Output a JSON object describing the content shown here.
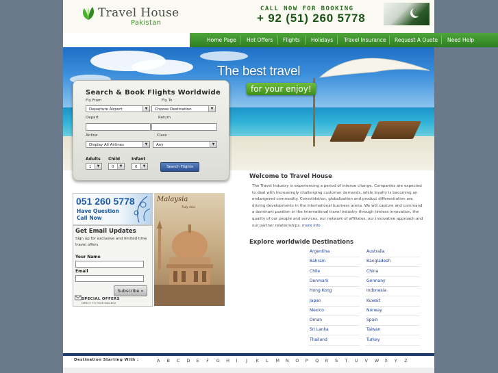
{
  "brand": {
    "name": "Travel House",
    "sub": "Pakistan"
  },
  "contact": {
    "call_label": "CALL NOW FOR BOOKING",
    "phone": "+ 92 (51) 260 5778"
  },
  "nav": {
    "items": [
      {
        "label": "Home Page"
      },
      {
        "label": "Hot Offers"
      },
      {
        "label": "Flights"
      },
      {
        "label": "Holidays"
      },
      {
        "label": "Travel Insurance"
      },
      {
        "label": "Request A Quote"
      },
      {
        "label": "Need Help"
      }
    ]
  },
  "hero": {
    "slogan_top": "The best travel",
    "slogan_bottom": "for your enjoy!"
  },
  "search": {
    "title": "Search & Book Flights Worldwide",
    "fly_from_label": "Fly From",
    "fly_from_value": "Departure Airport",
    "fly_to_label": "Fly To",
    "fly_to_value": "Choose Destination",
    "depart_label": "Depart",
    "return_label": "Return",
    "airline_label": "Airline",
    "airline_value": "Display All Airlines",
    "class_label": "Class",
    "class_value": "Any",
    "adults_label": "Adults",
    "adults_value": "1",
    "child_label": "Child",
    "child_value": "0",
    "infant_label": "Infant",
    "infant_value": "0",
    "button": "Search Flights"
  },
  "ad_phone": {
    "number": "051 260 5778",
    "line1": "Have Question",
    "line2": "Call Now"
  },
  "email": {
    "title": "Get Email Updates",
    "text": "Sign up for exclusive and limited time travel offers",
    "name_label": "Your Name",
    "email_label": "Email",
    "subscribe": "Subscribe »",
    "special": "SPECIAL OFFERS",
    "special_sub": "DIRECT TO YOUR MAILBOX"
  },
  "ad_malaysia": {
    "title": "Malaysia",
    "sub": "Truly Asia"
  },
  "welcome": {
    "heading": "Welcome to Travel House",
    "body": "The Travel Industry is experiencing a period of intense change. Companies are expected to deal with increasingly challenging customer demands, while loyalty is becoming an endangered commodity. Consolidation, globalization and product differentiation are driving developments in the international business arena. We will capture and command a dominant position in the international travel industry through tireless innovation, the quality of our people and services, our network of affiliates, our innovative approach and our partner relationships.",
    "more": "more info"
  },
  "destinations": {
    "heading": "Explore worldwide Destinations",
    "left": [
      "Argentina",
      "Bahrain",
      "Chile",
      "Denmark",
      "Hong Kong",
      "Japan",
      "Mexico",
      "Oman",
      "Sri Lanka",
      "Thailand"
    ],
    "right": [
      "Australia",
      "Bangladesh",
      "China",
      "Germany",
      "Indonesia",
      "Kuwait",
      "Norway",
      "Spain",
      "Taiwan",
      "Turkey"
    ]
  },
  "footer": {
    "label": "Destination Starting With :",
    "letters": [
      "A",
      "B",
      "C",
      "D",
      "E",
      "F",
      "G",
      "H",
      "I",
      "J",
      "K",
      "L",
      "M",
      "N",
      "O",
      "P",
      "Q",
      "R",
      "S",
      "T",
      "U",
      "V",
      "W",
      "X",
      "Y",
      "Z"
    ]
  },
  "colors": {
    "nav_green": "#3a8f2c",
    "link_blue": "#1c3e99",
    "brand_green": "#3e8a2a",
    "footer_navy": "#1f3b6a"
  }
}
